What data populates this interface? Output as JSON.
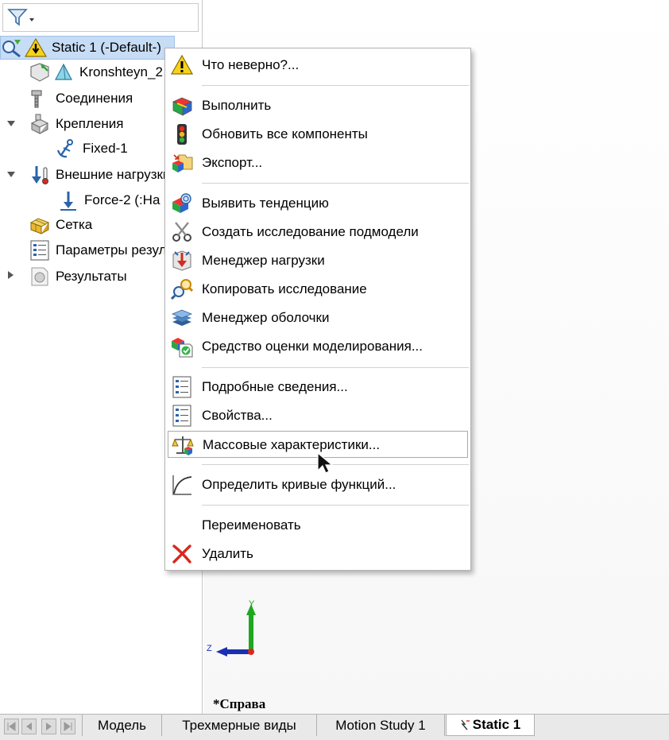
{
  "tree": {
    "filter_icon": "funnel-icon",
    "items": [
      {
        "label": "Static 1 (-Default-)",
        "icon": "study-warning-icon"
      },
      {
        "label": "Kronshteyn_2",
        "icon": "part-icon"
      },
      {
        "label": "Соединения",
        "icon": "connections-icon"
      },
      {
        "label": "Крепления",
        "icon": "fixtures-icon"
      },
      {
        "label": "Fixed-1",
        "icon": "anchor-icon"
      },
      {
        "label": "Внешние нагрузки",
        "icon": "external-loads-icon"
      },
      {
        "label": "Force-2 (:На",
        "icon": "force-arrow-icon"
      },
      {
        "label": "Сетка",
        "icon": "mesh-icon"
      },
      {
        "label": "Параметры результатов",
        "icon": "result-options-icon"
      },
      {
        "label": "Результаты",
        "icon": "results-icon"
      }
    ]
  },
  "menu": {
    "items": [
      {
        "label": "Что неверно?...",
        "icon": "warning-icon"
      },
      {
        "label": "Выполнить",
        "icon": "run-icon"
      },
      {
        "label": "Обновить все компоненты",
        "icon": "traffic-light-icon"
      },
      {
        "label": "Экспорт...",
        "icon": "export-icon"
      },
      {
        "label": "Выявить тенденцию",
        "icon": "trend-icon"
      },
      {
        "label": "Создать исследование подмодели",
        "icon": "scissors-icon"
      },
      {
        "label": "Менеджер нагрузки",
        "icon": "load-manager-icon"
      },
      {
        "label": "Копировать исследование",
        "icon": "copy-study-icon"
      },
      {
        "label": "Менеджер оболочки",
        "icon": "shell-manager-icon"
      },
      {
        "label": "Средство оценки моделирования...",
        "icon": "simulation-evaluator-icon"
      },
      {
        "label": "Подробные сведения...",
        "icon": "details-list-icon"
      },
      {
        "label": "Свойства...",
        "icon": "properties-list-icon"
      },
      {
        "label": "Массовые характеристики...",
        "icon": "mass-properties-icon"
      },
      {
        "label": "Определить кривые функций...",
        "icon": "curve-icon"
      },
      {
        "label": "Переименовать",
        "icon": ""
      },
      {
        "label": "Удалить",
        "icon": "delete-x-icon"
      }
    ]
  },
  "viewport": {
    "view_label": "*Справа",
    "triad": {
      "y": "Y",
      "z": "Z"
    }
  },
  "tabs": [
    {
      "label": "Модель"
    },
    {
      "label": "Трехмерные виды"
    },
    {
      "label": "Motion Study 1"
    },
    {
      "label": "Static 1",
      "active": true
    }
  ],
  "colors": {
    "selection": "#c7dcf5",
    "menu_border": "#b4b4b4",
    "delete_red": "#d62a1e",
    "warning_yellow": "#f7d21a"
  }
}
